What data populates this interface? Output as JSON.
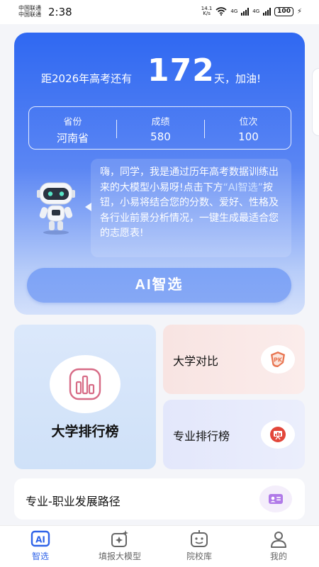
{
  "status_bar": {
    "carrier_1": "中国联通",
    "carrier_2": "中国联通",
    "time": "2:38",
    "net_speed_top": "14.1",
    "net_speed_bottom": "K/s",
    "signal_1": "4G",
    "signal_2": "4G",
    "battery": "100"
  },
  "hero": {
    "countdown_prefix": "距2026年高考还有",
    "countdown_days": "172",
    "countdown_suffix": "天，加油!",
    "scores": [
      {
        "label": "省份",
        "value": "河南省"
      },
      {
        "label": "成绩",
        "value": "580"
      },
      {
        "label": "位次",
        "value": "100"
      }
    ],
    "bubble_part1": "嗨，同学，我是通过历年高考数据训练出来的大模型小易呀!点击下方",
    "bubble_highlight": "“AI智选”",
    "bubble_part2": "按钮，小易将结合您的分数、爱好、性格及各行业前景分析情况，一键生成最适合您的志愿表!",
    "ai_button": "AI智选"
  },
  "features": {
    "ranking": "大学排行榜",
    "compare": "大学对比",
    "compare_icon_text": "PK",
    "major_ranking": "专业排行榜",
    "career_path": "专业-职业发展路径"
  },
  "nav": [
    {
      "label": "智选",
      "icon": "ai-icon",
      "icon_text": "AI"
    },
    {
      "label": "填报大模型",
      "icon": "sparkle-icon"
    },
    {
      "label": "院校库",
      "icon": "robot-face-icon"
    },
    {
      "label": "我的",
      "icon": "person-icon"
    }
  ],
  "colors": {
    "accent": "#2f63e8",
    "hero_top": "#2f68f2",
    "compare_icon": "#e8734f",
    "major_icon": "#e2463a",
    "ranking_icon": "#d76b86"
  }
}
